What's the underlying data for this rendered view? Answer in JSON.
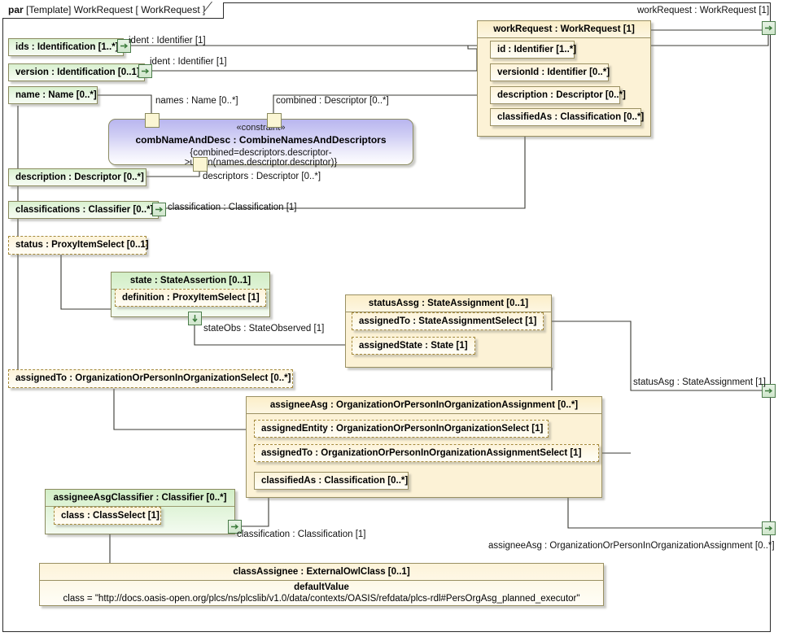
{
  "frame": {
    "keyword": "par",
    "title": "[Template] WorkRequest [ WorkRequest ]"
  },
  "blocks": {
    "ids": {
      "title": "ids : Identification [1..*]"
    },
    "version": {
      "title": "version : Identification [0..1]"
    },
    "name": {
      "title": "name : Name [0..*]"
    },
    "description": {
      "title": "description : Descriptor [0..*]"
    },
    "classifications": {
      "title": "classifications : Classifier [0..*]"
    },
    "status": {
      "title": "status : ProxyItemSelect [0..1]"
    },
    "state": {
      "title": "state : StateAssertion [0..1]",
      "definition": "definition : ProxyItemSelect [1]"
    },
    "workRequest": {
      "title": "workRequest : WorkRequest [1]",
      "parts": [
        "id : Identifier [1..*]",
        "versionId : Identifier [0..*]",
        "description : Descriptor [0..*]",
        "classifiedAs : Classification [0..*]"
      ]
    },
    "statusAssg": {
      "title": "statusAssg : StateAssignment [0..1]",
      "parts": [
        "assignedTo : StateAssignmentSelect [1]",
        "assignedState : State [1]"
      ]
    },
    "assignedTo": {
      "title": "assignedTo : OrganizationOrPersonInOrganizationSelect [0..*]"
    },
    "assigneeAsg": {
      "title": "assigneeAsg : OrganizationOrPersonInOrganizationAssignment [0..*]",
      "parts": [
        "assignedEntity : OrganizationOrPersonInOrganizationSelect [1]",
        "assignedTo : OrganizationOrPersonInOrganizationAssignmentSelect [1]",
        "classifiedAs : Classification [0..*]"
      ]
    },
    "assigneeAsgClassifier": {
      "title": "assigneeAsgClassifier : Classifier [0..*]",
      "parts": [
        "class : ClassSelect [1]"
      ]
    },
    "classAssignee": {
      "title": "classAssignee : ExternalOwlClass [0..1]",
      "compartment_title": "defaultValue",
      "compartment_value": "class = \"http://docs.oasis-open.org/plcs/ns/plcslib/v1.0/data/contexts/OASIS/refdata/plcs-rdl#PersOrgAsg_planned_executor\""
    }
  },
  "constraint": {
    "stereotype": "«constraint»",
    "name": "combNameAndDesc : CombineNamesAndDescriptors",
    "expression": "{combined=descriptors.descriptor->union(names.descriptor.descriptor)}"
  },
  "connector_labels": {
    "ident_ids": "ident : Identifier [1]",
    "ident_version": "ident : Identifier [1]",
    "names": "names : Name [0..*]",
    "combined": "combined : Descriptor [0..*]",
    "descriptors": "descriptors : Descriptor [0..*]",
    "classification_top": "classification : Classification [1]",
    "stateObs": "stateObs : StateObserved [1]",
    "classification_bottom": "classification : Classification [1]",
    "workRequest_port": "workRequest : WorkRequest [1]",
    "statusAsg_port": "statusAsg : StateAssignment [1]",
    "assigneeAsg_port": "assigneeAsg : OrganizationOrPersonInOrganizationAssignment [0..*]"
  },
  "colors": {
    "green_fill": "#d8f0ce",
    "cream_fill": "#fbedc5",
    "constraint_fill": "#b9b6ef",
    "port_green": "#4b7d4b",
    "line": "#3a3a33",
    "frame": "#2b2b2b"
  }
}
